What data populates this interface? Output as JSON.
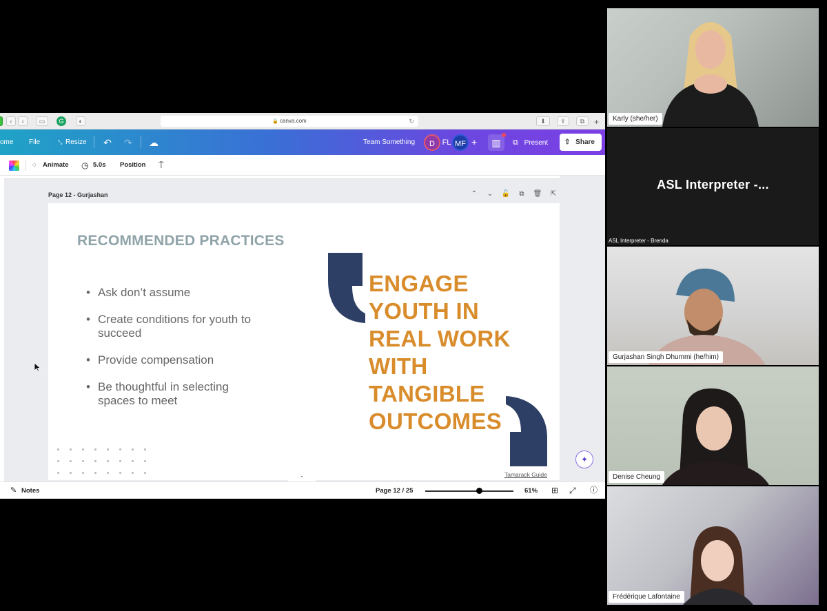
{
  "browser": {
    "url": "canva.com"
  },
  "canva_header": {
    "home_label": "ome",
    "file_label": "File",
    "resize_label": "Resize",
    "team_name": "Team Something",
    "avatars": [
      "D",
      "FL",
      "MF"
    ],
    "add_label": "+",
    "present_label": "Present",
    "share_label": "Share"
  },
  "toolbar": {
    "animate_label": "Animate",
    "duration_label": "5.0s",
    "position_label": "Position"
  },
  "page": {
    "label": "Page 12 - Gurjashan"
  },
  "slide": {
    "title": "RECOMMENDED PRACTICES",
    "bullets": [
      "Ask don’t assume",
      "Create conditions for youth to succeed",
      "Provide compensation",
      "Be thoughtful in selecting spaces to meet"
    ],
    "quote_lines": [
      "ENGAGE",
      "YOUTH IN",
      "REAL WORK",
      "WITH",
      "TANGIBLE",
      "OUTCOMES"
    ],
    "source": "Tamarack Guide",
    "quote_mark_color": "#2e3f66",
    "quote_text_color": "#d98c2b",
    "title_color": "#8fa3a8"
  },
  "bottom_bar": {
    "notes_label": "Notes",
    "page_indicator": "Page 12 / 25",
    "zoom_percent": "61%",
    "zoom_level": 0.61
  },
  "participants": [
    {
      "name": "Karly (she/her)"
    },
    {
      "name": "ASL Interpreter -...",
      "caption": "ASL Interpreter - Brenda"
    },
    {
      "name": "Gurjashan Singh Dhummi (he/him)"
    },
    {
      "name": "Denise Cheung"
    },
    {
      "name": "Frédérique Lafontaine"
    }
  ]
}
